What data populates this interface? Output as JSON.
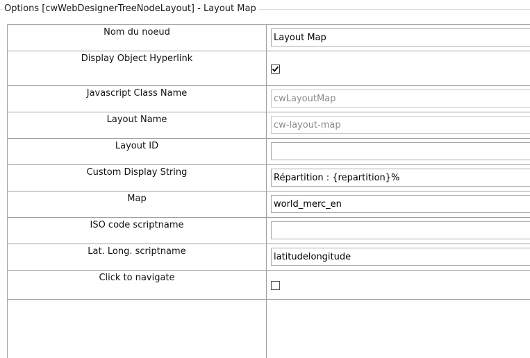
{
  "window": {
    "title": "Options [cwWebDesignerTreeNodeLayout] - Layout Map"
  },
  "fields": [
    {
      "label": "Nom du noeud",
      "type": "text",
      "value": "Layout Map",
      "readonly": false
    },
    {
      "label": "Display Object Hyperlink",
      "type": "checkbox",
      "checked": true
    },
    {
      "label": "Javascript Class Name",
      "type": "text",
      "value": "cwLayoutMap",
      "readonly": true
    },
    {
      "label": "Layout Name",
      "type": "text",
      "value": "cw-layout-map",
      "readonly": true
    },
    {
      "label": "Layout ID",
      "type": "text",
      "value": "",
      "readonly": false
    },
    {
      "label": "Custom Display String",
      "type": "text",
      "value": "Répartition : {repartition}%",
      "readonly": false
    },
    {
      "label": "Map",
      "type": "text",
      "value": "world_merc_en",
      "readonly": false
    },
    {
      "label": "ISO code scriptname",
      "type": "text",
      "value": "",
      "readonly": false
    },
    {
      "label": "Lat. Long. scriptname",
      "type": "text",
      "value": "latitudelongitude",
      "readonly": false
    },
    {
      "label": "Click to navigate",
      "type": "checkbox",
      "checked": false
    }
  ],
  "colors": {
    "border": "#a0a0a0",
    "readonly_text": "#8a8a8a",
    "background": "#ffffff"
  }
}
